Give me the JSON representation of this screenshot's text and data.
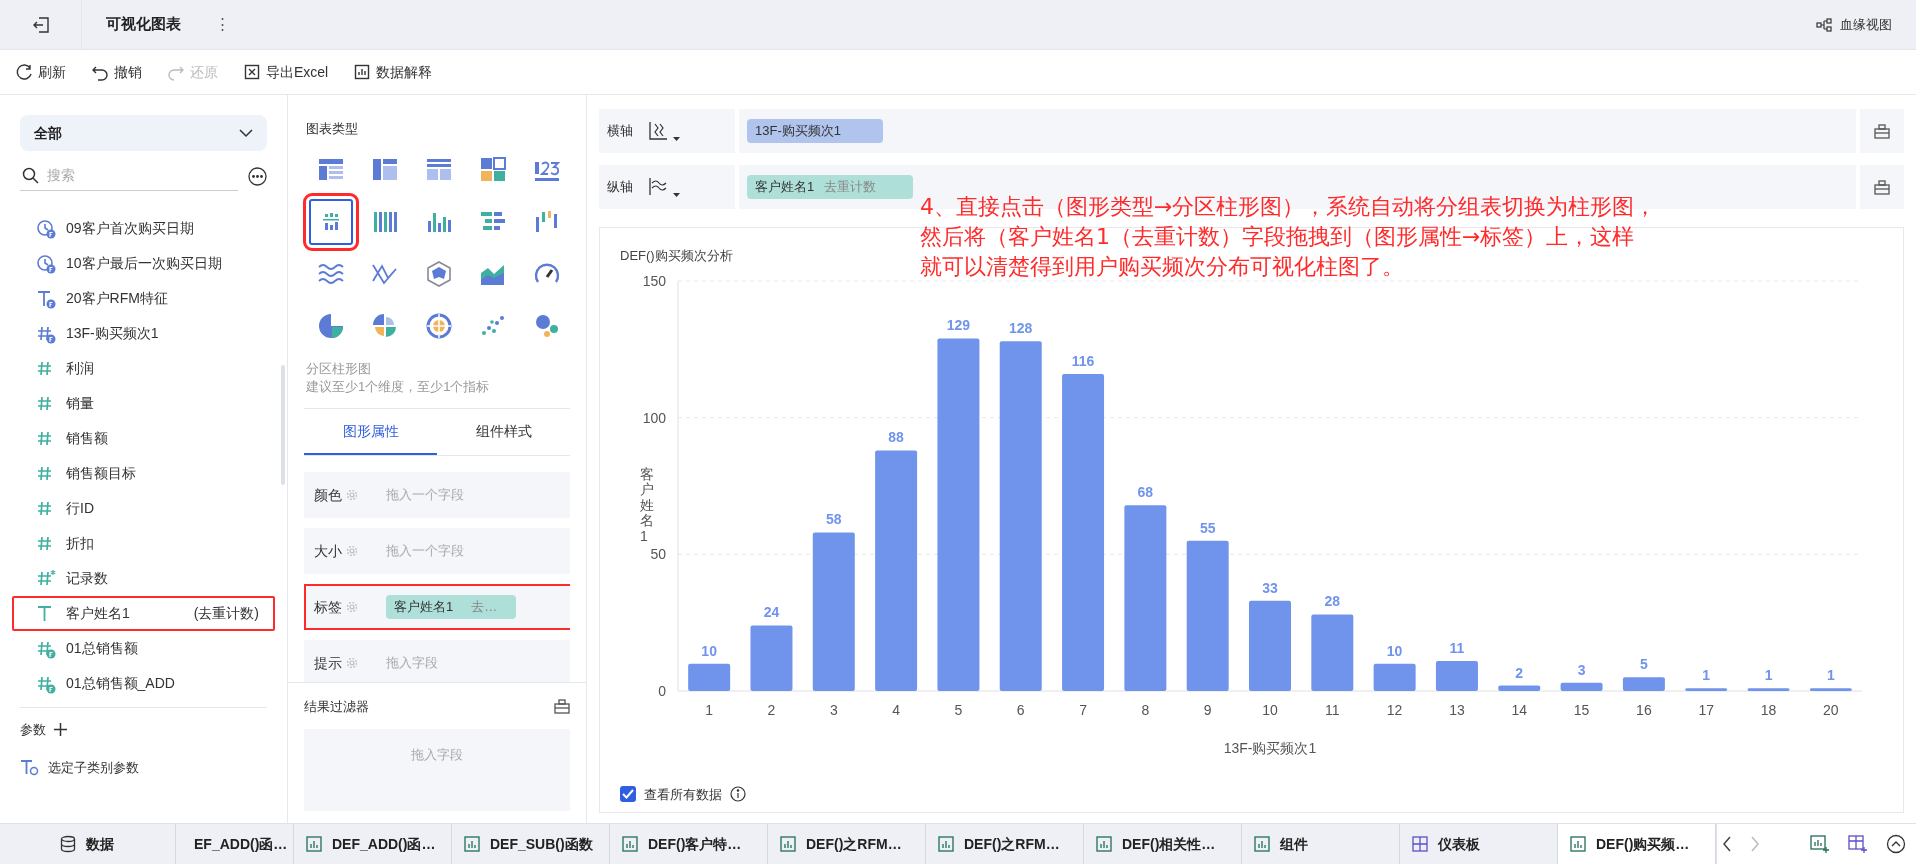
{
  "top_bar": {
    "title": "可视化图表",
    "more": "⋮",
    "lineage_button": "血缘视图"
  },
  "toolbar": [
    {
      "label": "刷新",
      "kind": "refresh",
      "disabled": false
    },
    {
      "label": "撤销",
      "kind": "undo",
      "disabled": false
    },
    {
      "label": "还原",
      "kind": "redo",
      "disabled": true
    },
    {
      "label": "导出Excel",
      "kind": "excel",
      "disabled": false
    },
    {
      "label": "数据解释",
      "kind": "explain",
      "disabled": false
    }
  ],
  "fields_panel": {
    "scope": "全部",
    "search_placeholder": "搜索",
    "fields": [
      {
        "name": "09客户首次购买日期",
        "kind": "date_calc",
        "highlighted": false
      },
      {
        "name": "10客户最后一次购买日期",
        "kind": "date_calc",
        "highlighted": false
      },
      {
        "name": "20客户RFM特征",
        "kind": "text_calc",
        "highlighted": false
      },
      {
        "name": "13F-购买频次1",
        "kind": "num_calc_dim",
        "highlighted": false
      },
      {
        "name": "利润",
        "kind": "measure",
        "highlighted": false
      },
      {
        "name": "销量",
        "kind": "measure",
        "highlighted": false
      },
      {
        "name": "销售额",
        "kind": "measure",
        "highlighted": false
      },
      {
        "name": "销售额目标",
        "kind": "measure",
        "highlighted": false
      },
      {
        "name": "行ID",
        "kind": "measure",
        "highlighted": false
      },
      {
        "name": "折扣",
        "kind": "measure",
        "highlighted": false
      },
      {
        "name": "记录数",
        "kind": "count",
        "highlighted": false
      },
      {
        "name": "客户姓名1",
        "suffix": "(去重计数)",
        "kind": "text_measure",
        "highlighted": true
      },
      {
        "name": "01总销售额",
        "kind": "num_calc_measure",
        "highlighted": false
      },
      {
        "name": "01总销售额_ADD",
        "kind": "num_calc_measure",
        "highlighted": false
      }
    ],
    "parameters_label": "参数",
    "parameters": [
      {
        "label": "选定子类别参数"
      }
    ]
  },
  "chart_type_panel": {
    "title": "图表类型",
    "types": [
      {
        "kind": "table",
        "selected": false,
        "highlighted": false
      },
      {
        "kind": "crosstab",
        "selected": false,
        "highlighted": false
      },
      {
        "kind": "detail",
        "selected": false,
        "highlighted": false
      },
      {
        "kind": "tiles",
        "selected": false,
        "highlighted": false
      },
      {
        "kind": "number",
        "selected": false,
        "highlighted": false
      },
      {
        "kind": "partition_bar",
        "selected": true,
        "highlighted": true
      },
      {
        "kind": "multi_bar",
        "selected": false,
        "highlighted": false
      },
      {
        "kind": "bar",
        "selected": false,
        "highlighted": false
      },
      {
        "kind": "hbar",
        "selected": false,
        "highlighted": false
      },
      {
        "kind": "waterfall",
        "selected": false,
        "highlighted": false
      },
      {
        "kind": "wave",
        "selected": false,
        "highlighted": false
      },
      {
        "kind": "cross_line",
        "selected": false,
        "highlighted": false
      },
      {
        "kind": "radar",
        "selected": false,
        "highlighted": false
      },
      {
        "kind": "area",
        "selected": false,
        "highlighted": false
      },
      {
        "kind": "gauge",
        "selected": false,
        "highlighted": false
      },
      {
        "kind": "pie",
        "selected": false,
        "highlighted": false
      },
      {
        "kind": "rose",
        "selected": false,
        "highlighted": false
      },
      {
        "kind": "sunburst",
        "selected": false,
        "highlighted": false
      },
      {
        "kind": "scatter",
        "selected": false,
        "highlighted": false
      },
      {
        "kind": "bubble",
        "selected": false,
        "highlighted": false
      }
    ],
    "selected_name": "分区柱形图",
    "hint": "建议至少1个维度，至少1个指标"
  },
  "property_tabs": [
    {
      "label": "图形属性",
      "selected": true
    },
    {
      "label": "组件样式",
      "selected": false
    }
  ],
  "properties": [
    {
      "label": "颜色",
      "placeholder": "拖入一个字段",
      "highlighted": false
    },
    {
      "label": "大小",
      "placeholder": "拖入一个字段",
      "highlighted": false
    },
    {
      "label": "标签",
      "field": "客户姓名1",
      "aggregation": "去…",
      "highlighted": true
    },
    {
      "label": "提示",
      "placeholder": "拖入字段",
      "highlighted": false
    }
  ],
  "result_filter": {
    "title": "结果过滤器",
    "placeholder": "拖入字段"
  },
  "axes": [
    {
      "label": "横轴",
      "field": "13F-购买频次1",
      "kind": "dimension"
    },
    {
      "label": "纵轴",
      "field": "客户姓名1",
      "aggregation": "去重计数",
      "kind": "measure"
    }
  ],
  "chart": {
    "chart_data": {
      "type": "bar",
      "title": "DEF()购买频次分析",
      "xlabel": "13F-购买频次1",
      "ylabel": "客户姓名1",
      "categories": [
        "1",
        "2",
        "3",
        "4",
        "5",
        "6",
        "7",
        "8",
        "9",
        "10",
        "11",
        "12",
        "13",
        "14",
        "15",
        "16",
        "17",
        "18",
        "20"
      ],
      "values": [
        10,
        24,
        58,
        88,
        129,
        128,
        116,
        68,
        55,
        33,
        28,
        10,
        11,
        2,
        3,
        5,
        1,
        1,
        1
      ],
      "ylim": [
        0,
        150
      ],
      "yticks": [
        0,
        50,
        100,
        150
      ],
      "data_labels": true
    },
    "show_all_data": {
      "label": "查看所有数据",
      "checked": true
    }
  },
  "annotation": {
    "lines": [
      "4、直接点击（图形类型→分区柱形图），系统自动将分组表切换为柱形图，",
      "然后将（客户姓名1（去重计数）字段拖拽到（图形属性→标签）上，这样",
      "就可以清楚得到用户购买频次分布可视化柱图了。"
    ]
  },
  "bottom_tabs": [
    {
      "label": "数据",
      "kind": "data",
      "selected": false
    },
    {
      "label": "EF_ADD()函…",
      "kind": "clipped",
      "selected": false
    },
    {
      "label": "DEF_ADD()函…",
      "kind": "chart",
      "selected": false
    },
    {
      "label": "DEF_SUB()函数",
      "kind": "chart",
      "selected": false
    },
    {
      "label": "DEF()客户特…",
      "kind": "chart",
      "selected": false
    },
    {
      "label": "DEF()之RFM…",
      "kind": "chart",
      "selected": false
    },
    {
      "label": "DEF()之RFM…",
      "kind": "chart",
      "selected": false
    },
    {
      "label": "DEF()相关性…",
      "kind": "chart",
      "selected": false
    },
    {
      "label": "组件",
      "kind": "chart",
      "selected": false
    },
    {
      "label": "仪表板",
      "kind": "dashboard",
      "selected": false
    },
    {
      "label": "DEF()购买频…",
      "kind": "chart",
      "selected": true
    }
  ]
}
